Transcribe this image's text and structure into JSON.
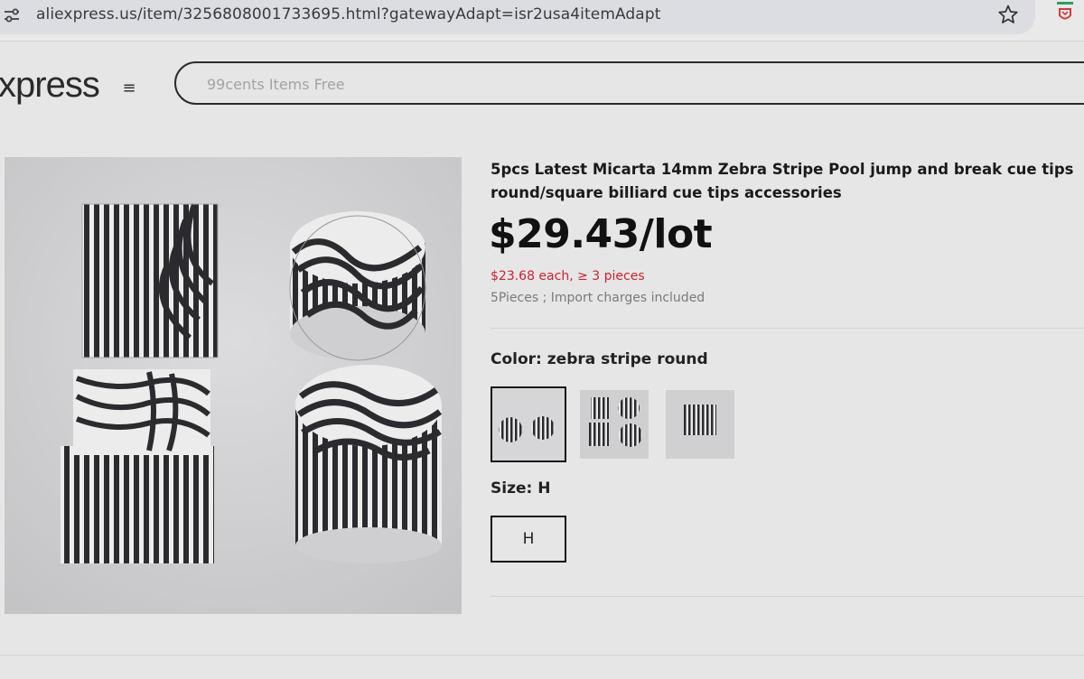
{
  "browser": {
    "url": "aliexpress.us/item/3256808001733695.html?gatewayAdapt=isr2usa4itemAdapt"
  },
  "header": {
    "logo_text": "xpress",
    "menu_glyph": "≡",
    "search_placeholder": "99cents Items Free"
  },
  "product": {
    "title": "5pcs Latest Micarta 14mm Zebra Stripe Pool jump and break cue tips round/square billiard cue tips accessories",
    "price": "$29.43/lot",
    "bulk_discount": "$23.68 each, ≥ 3 pieces",
    "shipping_note": "5Pieces ; Import charges included",
    "color": {
      "label": "Color: ",
      "selected": "zebra stripe round",
      "options": [
        "zebra stripe round",
        "option-2",
        "option-3"
      ]
    },
    "size": {
      "label": "Size: ",
      "selected": "H",
      "options": [
        "H"
      ]
    }
  },
  "icons": {
    "site_settings": "tune-icon",
    "bookmark": "star-icon",
    "extension": "shield-extension-icon",
    "menu": "hamburger-menu-icon"
  },
  "colors": {
    "page_bg": "#e6e6e6",
    "price_discount": "#cc2233",
    "text": "#111111"
  }
}
